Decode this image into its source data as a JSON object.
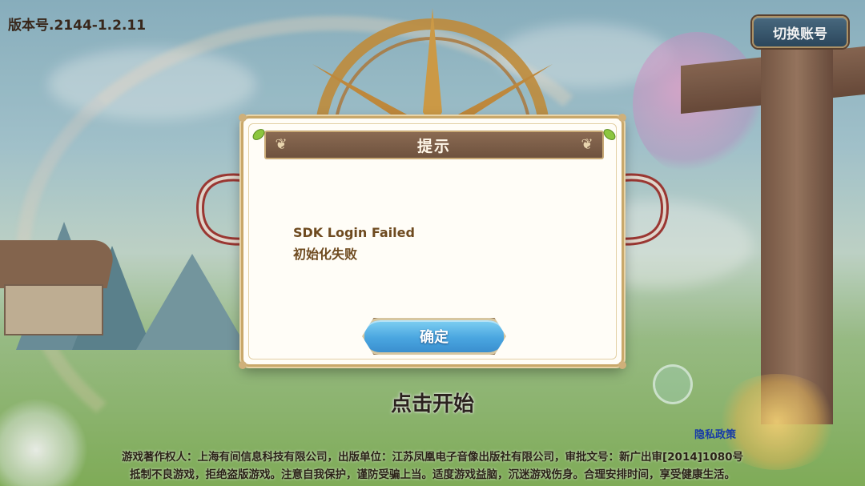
{
  "hud": {
    "version": "版本号.2144-1.2.11",
    "switch_account": "切换账号",
    "tap_to_start": "点击开始",
    "privacy_policy": "隐私政策"
  },
  "legal": {
    "line1": "游戏著作权人：上海有间信息科技有限公司，出版单位：江苏凤凰电子音像出版社有限公司，审批文号：新广出审[2014]1080号",
    "line2": "抵制不良游戏，拒绝盗版游戏。注意自我保护，谨防受骗上当。适度游戏益脑，沉迷游戏伤身。合理安排时间，享受健康生活。"
  },
  "dialog": {
    "title": "提示",
    "message_line1": "SDK Login Failed",
    "message_line2": "初始化失败",
    "confirm_label": "确定"
  },
  "colors": {
    "dialog_title_bar": "#7a5c46",
    "dialog_text": "#6e4a1f",
    "confirm_button": "#4aa6e0",
    "switch_account_button": "#3b5d75",
    "privacy_link": "#1a3fb0"
  }
}
